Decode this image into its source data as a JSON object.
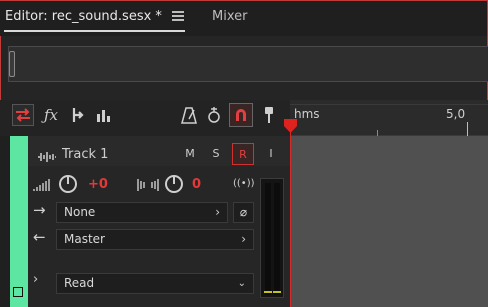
{
  "tabs": {
    "editor_label": "Editor: rec_sound.sesx *",
    "mixer_label": "Mixer"
  },
  "toolbar": {
    "icons": [
      "input-output-icon",
      "fx-icon",
      "sends-icon",
      "eq-icon",
      "metronome-icon",
      "loop-record-icon",
      "record-snap-icon",
      "pin-icon"
    ]
  },
  "ruler": {
    "unit_label": "hms",
    "tick_label": "5,0"
  },
  "track": {
    "name": "Track 1",
    "mute_label": "M",
    "solo_label": "S",
    "record_label": "R",
    "input_monitor_label": "I",
    "volume_value": "+0",
    "pan_value": "0",
    "input_value": "None",
    "output_value": "Master",
    "automation_mode": "Read",
    "color": "#5ce6a2"
  },
  "colors": {
    "accent_red": "#e24040",
    "track_green": "#5ce6a2"
  }
}
